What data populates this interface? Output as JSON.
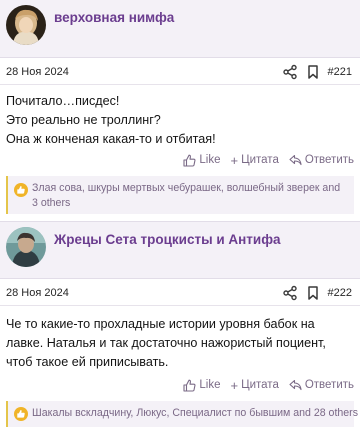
{
  "posts": [
    {
      "author": "верховная нимфа",
      "date": "28 Ноя 2024",
      "number": "#221",
      "body": [
        "Почитало…писдес!",
        "Это реально не троллинг?",
        "Она ж конченая какая-то и отбитая!"
      ],
      "actions": {
        "like": "Like",
        "quote": "Цитата",
        "reply": "Ответить"
      },
      "reactions": "Злая сова, шкуры мертвых чебурашек, волшебный зверек and 3 others"
    },
    {
      "author": "Жрецы Сета троцкисты и Антифа",
      "date": "28 Ноя 2024",
      "number": "#222",
      "body": [
        "Че то какие-то прохладные истории уровня бабок на",
        "лавке. Наталья и так достаточно нажористый поциент,",
        "чтоб такое ей приписывать."
      ],
      "actions": {
        "like": "Like",
        "quote": "Цитата",
        "reply": "Ответить"
      },
      "reactions": "Шакалы вскладчину, Люкус, Специалист по бывшим and 28 others"
    }
  ],
  "icons": {
    "share": "share-icon",
    "bookmark": "bookmark-icon",
    "like": "thumbs-up-icon",
    "quote": "plus-icon",
    "reply": "reply-arrow-icon",
    "reaction": "thumbs-up-reaction-icon"
  },
  "colors": {
    "author_name": "#6b3d8f",
    "author_bar_bg": "#f4f1f7",
    "action_text": "#7a6a86",
    "reaction_accent": "#e4c54a",
    "reaction_icon_bg": "#f0b428"
  }
}
